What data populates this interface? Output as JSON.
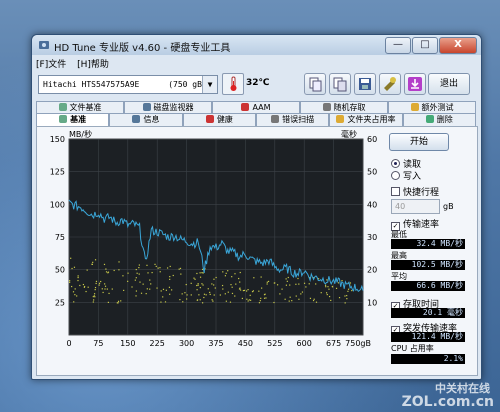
{
  "window": {
    "title": "HD Tune 专业版 v4.60 - 硬盘专业工具",
    "controls": {
      "minimize": "—",
      "maximize": "□",
      "close": "X"
    }
  },
  "menu": {
    "file": "[F]文件",
    "help": "[H]帮助"
  },
  "toolbar": {
    "drive": "Hitachi HTS547575A9E      (750 gB)",
    "temperature": "32℃",
    "exit_label": "退出",
    "buttons": [
      "copy-icon",
      "copy-all-icon",
      "save-icon",
      "options-icon",
      "download-icon"
    ]
  },
  "tabs_top": [
    {
      "label": "文件基准",
      "icon": "file-bench-icon"
    },
    {
      "label": "磁盘监视器",
      "icon": "monitor-icon"
    },
    {
      "label": "AAM",
      "icon": "speaker-icon"
    },
    {
      "label": "随机存取",
      "icon": "random-icon"
    },
    {
      "label": "额外测试",
      "icon": "extra-icon"
    }
  ],
  "tabs_bottom": [
    {
      "label": "基准",
      "icon": "benchmark-icon",
      "active": true
    },
    {
      "label": "信息",
      "icon": "info-icon"
    },
    {
      "label": "健康",
      "icon": "health-icon"
    },
    {
      "label": "错误扫描",
      "icon": "scan-icon"
    },
    {
      "label": "文件夹占用率",
      "icon": "folder-icon"
    },
    {
      "label": "删除",
      "icon": "erase-icon"
    }
  ],
  "right_panel": {
    "start": "开始",
    "read": "读取",
    "write": "写入",
    "short_stroke": "快捷行程",
    "short_stroke_value": "40",
    "short_stroke_unit": "gB",
    "transfer_rate": "传输速率",
    "min_label": "最低",
    "min_value": "32.4 MB/秒",
    "max_label": "最高",
    "max_value": "102.5 MB/秒",
    "avg_label": "平均",
    "avg_value": "66.6 MB/秒",
    "access_time": "存取时间",
    "access_value": "20.1 毫秒",
    "burst_rate": "突发传输速率",
    "burst_value": "121.4 MB/秒",
    "cpu_label": "CPU 占用率",
    "cpu_value": "2.1%"
  },
  "chart_data": {
    "type": "line",
    "y_left_label": "MB/秒",
    "y_right_label": "毫秒",
    "y_left_ticks": [
      "150",
      "125",
      "100",
      "75",
      "50",
      "25"
    ],
    "y_right_ticks": [
      "60",
      "50",
      "40",
      "30",
      "20",
      "10"
    ],
    "x_ticks": [
      "0",
      "75",
      "150",
      "225",
      "300",
      "375",
      "450",
      "525",
      "600",
      "675",
      "750gB"
    ],
    "ylim": [
      0,
      150
    ],
    "y2lim": [
      0,
      60
    ],
    "xlim": [
      0,
      750
    ],
    "grid": true,
    "series": [
      {
        "color": "#3aa6d8",
        "x": [
          0,
          15,
          30,
          45,
          60,
          75,
          90,
          105,
          120,
          135,
          150,
          165,
          180,
          195,
          210,
          225,
          240,
          255,
          270,
          285,
          300,
          315,
          330,
          345,
          360,
          375,
          390,
          405,
          420,
          435,
          450,
          465,
          480,
          495,
          510,
          525,
          540,
          555,
          570,
          585,
          600,
          615,
          630,
          645,
          660,
          675,
          690,
          705,
          720,
          735,
          750
        ],
        "values": [
          101,
          99,
          98,
          95,
          92,
          94,
          89,
          90,
          86,
          88,
          84,
          85,
          82,
          55,
          80,
          79,
          77,
          75,
          76,
          73,
          72,
          70,
          71,
          50,
          68,
          67,
          70,
          64,
          63,
          60,
          62,
          58,
          56,
          55,
          57,
          52,
          50,
          51,
          48,
          47,
          49,
          45,
          44,
          43,
          42,
          41,
          40,
          38,
          37,
          36,
          34
        ]
      }
    ],
    "access_points_color": "#c8c84a",
    "access_points_ms_range": [
      10,
      24
    ]
  },
  "watermark": {
    "line1": "中关村在线",
    "line2": "ZOL.com.cn"
  }
}
